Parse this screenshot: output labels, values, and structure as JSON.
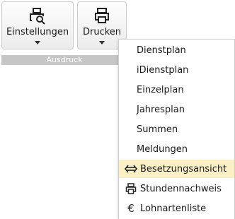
{
  "ribbon": {
    "einstellungen_label": "Einstellungen",
    "drucken_label": "Drucken",
    "group_label": "Ausdruck"
  },
  "menu": {
    "items": [
      {
        "label": "Dienstplan"
      },
      {
        "label": "iDienstplan"
      },
      {
        "label": "Einzelplan"
      },
      {
        "label": "Jahresplan"
      },
      {
        "label": "Summen"
      },
      {
        "label": "Meldungen"
      },
      {
        "label": "Besetzungsansicht",
        "icon": "arrows-horizontal-icon",
        "highlighted": true
      },
      {
        "label": "Stundennachweis",
        "icon": "printer-icon"
      },
      {
        "label": "Lohnartenliste",
        "icon": "euro-icon"
      }
    ]
  },
  "icons": {
    "euro_glyph": "€"
  },
  "colors": {
    "highlight": "#fbf0c5",
    "group_bar": "#c6c6c6"
  }
}
